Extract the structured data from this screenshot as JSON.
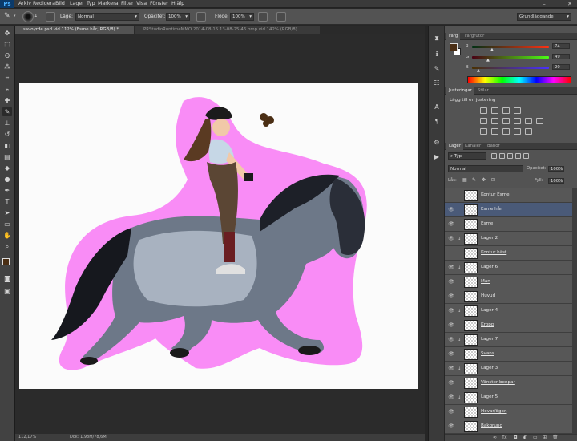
{
  "app": {
    "logo": "Ps"
  },
  "menu": [
    "Arkiv",
    "Redigera",
    "Bild",
    "Lager",
    "Typ",
    "Markera",
    "Filter",
    "Visa",
    "Fönster",
    "Hjälp"
  ],
  "options": {
    "mode_label": "Läge:",
    "mode_value": "Normal",
    "opacity_label": "Opacitet:",
    "opacity_value": "100%",
    "flow_label": "Flöde:",
    "flow_value": "100%",
    "brush_size": "1",
    "workspace": "Grundläggande"
  },
  "tabs": [
    {
      "label": "savoyrde.psd vid 112% (Esme hår, RGB/8) *",
      "active": true
    },
    {
      "label": "PRStudioRuntimeMMO 2014-08-15 13-08-25-46.bmp vid 142% (RGB/8)",
      "active": false
    }
  ],
  "status": {
    "zoom": "112,17%",
    "doc": "Dok: 1,98M/78,6M"
  },
  "color_panel": {
    "tabs": [
      "Färg",
      "Färgrutor"
    ],
    "fg_color": "#4a2e14",
    "bg_color": "#ffffff",
    "channels": [
      {
        "label": "R",
        "value": "74"
      },
      {
        "label": "G",
        "value": "49"
      },
      {
        "label": "B",
        "value": "20"
      }
    ]
  },
  "adjust_panel": {
    "tabs": [
      "Justeringar",
      "Stilar"
    ],
    "title": "Lägg till en justering"
  },
  "layers_panel": {
    "tabs": [
      "Lager",
      "Kanaler",
      "Banor"
    ],
    "filter_label": "Typ",
    "blend_mode": "Normal",
    "opacity_label": "Opacitet:",
    "opacity_value": "100%",
    "lock_label": "Lås:",
    "fill_label": "Fyll:",
    "fill_value": "100%",
    "layers": [
      {
        "name": "Kontur Esme",
        "visible": false,
        "selected": false,
        "clipped": false,
        "underline": false
      },
      {
        "name": "Esme hår",
        "visible": true,
        "selected": true,
        "clipped": false,
        "underline": false
      },
      {
        "name": "Esme",
        "visible": true,
        "selected": false,
        "clipped": false,
        "underline": false
      },
      {
        "name": "Lager 2",
        "visible": true,
        "selected": false,
        "clipped": true,
        "underline": false
      },
      {
        "name": "Kontur häst",
        "visible": false,
        "selected": false,
        "clipped": false,
        "underline": true
      },
      {
        "name": "Lager 6",
        "visible": true,
        "selected": false,
        "clipped": true,
        "underline": false
      },
      {
        "name": "Man",
        "visible": true,
        "selected": false,
        "clipped": false,
        "underline": true
      },
      {
        "name": "Huvud",
        "visible": true,
        "selected": false,
        "clipped": false,
        "underline": false
      },
      {
        "name": "Lager 4",
        "visible": true,
        "selected": false,
        "clipped": true,
        "underline": false
      },
      {
        "name": "Kropp",
        "visible": true,
        "selected": false,
        "clipped": false,
        "underline": true
      },
      {
        "name": "Lager 7",
        "visible": true,
        "selected": false,
        "clipped": true,
        "underline": false
      },
      {
        "name": "Svans",
        "visible": true,
        "selected": false,
        "clipped": false,
        "underline": true
      },
      {
        "name": "Lager 3",
        "visible": true,
        "selected": false,
        "clipped": true,
        "underline": false
      },
      {
        "name": "Vänster benpar",
        "visible": true,
        "selected": false,
        "clipped": false,
        "underline": true
      },
      {
        "name": "Lager 5",
        "visible": true,
        "selected": false,
        "clipped": true,
        "underline": false
      },
      {
        "name": "Hovar/ögon",
        "visible": true,
        "selected": false,
        "clipped": false,
        "underline": true
      },
      {
        "name": "Bakgrund",
        "visible": true,
        "selected": false,
        "clipped": false,
        "underline": true
      }
    ]
  }
}
